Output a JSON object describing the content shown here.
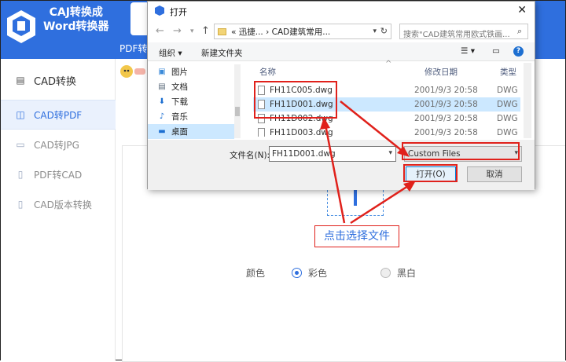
{
  "app": {
    "title_line1": "CAJ转换成",
    "title_line2": "Word转换器",
    "toolbar_label": "PDF转",
    "brand_color": "#2f6fde"
  },
  "sidebar": {
    "header": "CAD转换",
    "items": [
      {
        "label": "CAD转PDF",
        "icon": "pdf-icon",
        "active": true
      },
      {
        "label": "CAD转JPG",
        "icon": "jpg-icon",
        "active": false
      },
      {
        "label": "PDF转CAD",
        "icon": "file-icon",
        "active": false
      },
      {
        "label": "CAD版本转换",
        "icon": "file-icon",
        "active": false
      }
    ]
  },
  "options": {
    "color_label": "颜色",
    "color_choice": "彩色",
    "bw_choice": "黑白",
    "selected": "彩色"
  },
  "dialog": {
    "title": "打开",
    "address": "« 迅捷...  ›  CAD建筑常用...",
    "search_placeholder": "搜索\"CAD建筑常用欧式铁画...",
    "organize": "组织 ▾",
    "new_folder": "新建文件夹",
    "nav_items": [
      {
        "label": "图片",
        "icon": "pictures-icon"
      },
      {
        "label": "文档",
        "icon": "documents-icon"
      },
      {
        "label": "下载",
        "icon": "download-icon"
      },
      {
        "label": "音乐",
        "icon": "music-icon"
      },
      {
        "label": "桌面",
        "icon": "desktop-icon",
        "selected": true
      }
    ],
    "columns": {
      "name": "名称",
      "date": "修改日期",
      "type": "类型"
    },
    "files": [
      {
        "name": "FH11C005.dwg",
        "date": "2001/9/3 20:58",
        "type": "DWG",
        "selected": false
      },
      {
        "name": "FH11D001.dwg",
        "date": "2001/9/3 20:58",
        "type": "DWG",
        "selected": true
      },
      {
        "name": "FH11D002.dwg",
        "date": "2001/9/3 20:58",
        "type": "DWG",
        "selected": false
      },
      {
        "name": "FH11D003.dwg",
        "date": "2001/9/3 20:58",
        "type": "DWG",
        "selected": false
      }
    ],
    "filename_label": "文件名(N):",
    "filename_value": "FH11D001.dwg",
    "filter_value": "Custom Files",
    "open_button": "打开(O)",
    "cancel_button": "取消"
  },
  "annotation": {
    "text": "点击选择文件",
    "color": "#e0211b"
  }
}
